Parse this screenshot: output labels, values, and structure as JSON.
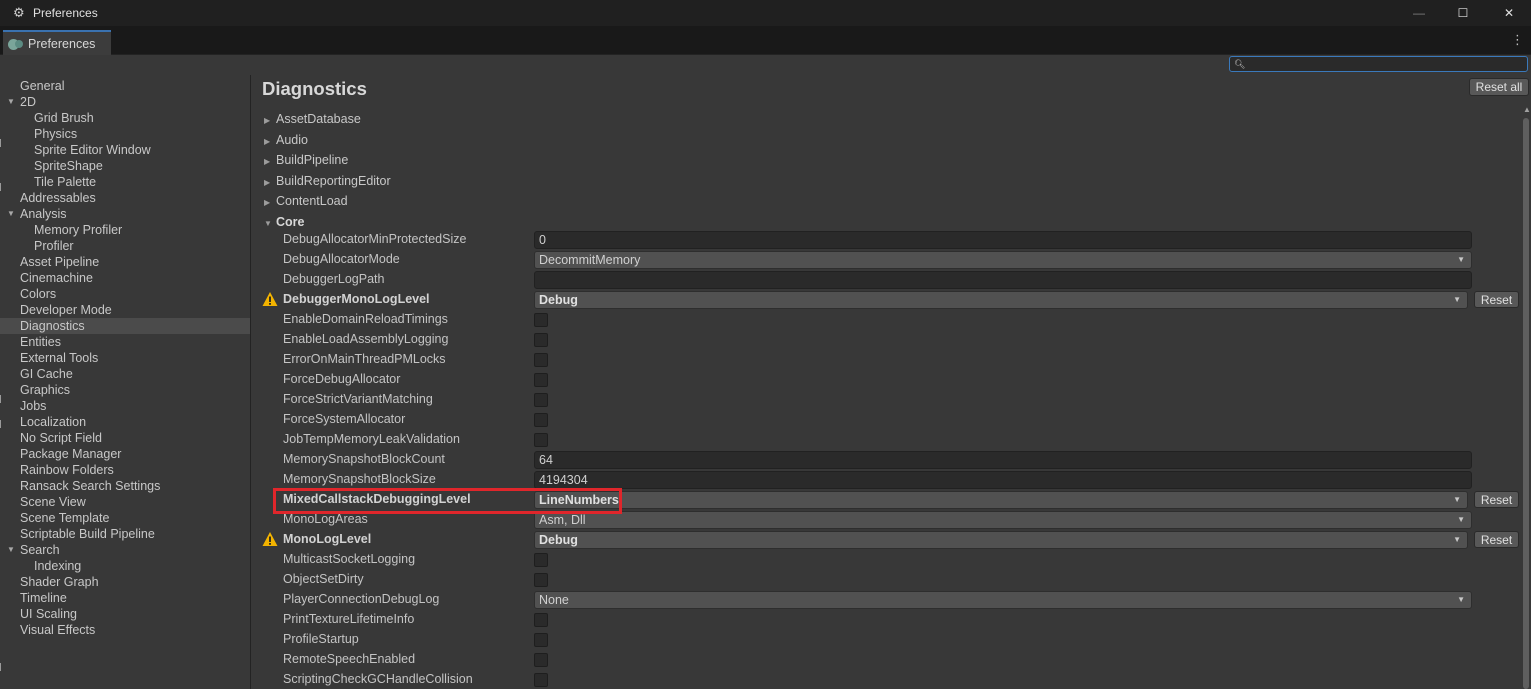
{
  "window": {
    "title": "Preferences",
    "tab_label": "Preferences",
    "minimize_glyph": "—",
    "maximize_glyph": "☐",
    "close_glyph": "✕",
    "more_glyph": "⋮"
  },
  "search": {
    "value": "",
    "placeholder": ""
  },
  "sidebar": {
    "items": [
      {
        "label": "General",
        "level": 0
      },
      {
        "label": "2D",
        "level": 0,
        "expanded": true
      },
      {
        "label": "Grid Brush",
        "level": 1
      },
      {
        "label": "Physics",
        "level": 1
      },
      {
        "label": "Sprite Editor Window",
        "level": 1
      },
      {
        "label": "SpriteShape",
        "level": 1
      },
      {
        "label": "Tile Palette",
        "level": 1
      },
      {
        "label": "Addressables",
        "level": 0
      },
      {
        "label": "Analysis",
        "level": 0,
        "expanded": true
      },
      {
        "label": "Memory Profiler",
        "level": 1
      },
      {
        "label": "Profiler",
        "level": 1
      },
      {
        "label": "Asset Pipeline",
        "level": 0
      },
      {
        "label": "Cinemachine",
        "level": 0
      },
      {
        "label": "Colors",
        "level": 0
      },
      {
        "label": "Developer Mode",
        "level": 0
      },
      {
        "label": "Diagnostics",
        "level": 0,
        "selected": true
      },
      {
        "label": "Entities",
        "level": 0
      },
      {
        "label": "External Tools",
        "level": 0
      },
      {
        "label": "GI Cache",
        "level": 0
      },
      {
        "label": "Graphics",
        "level": 0
      },
      {
        "label": "Jobs",
        "level": 0
      },
      {
        "label": "Localization",
        "level": 0
      },
      {
        "label": "No Script Field",
        "level": 0
      },
      {
        "label": "Package Manager",
        "level": 0
      },
      {
        "label": "Rainbow Folders",
        "level": 0
      },
      {
        "label": "Ransack Search Settings",
        "level": 0
      },
      {
        "label": "Scene View",
        "level": 0
      },
      {
        "label": "Scene Template",
        "level": 0
      },
      {
        "label": "Scriptable Build Pipeline",
        "level": 0
      },
      {
        "label": "Search",
        "level": 0,
        "expanded": true
      },
      {
        "label": "Indexing",
        "level": 1
      },
      {
        "label": "Shader Graph",
        "level": 0
      },
      {
        "label": "Timeline",
        "level": 0
      },
      {
        "label": "UI Scaling",
        "level": 0
      },
      {
        "label": "Visual Effects",
        "level": 0
      }
    ]
  },
  "main": {
    "title": "Diagnostics",
    "reset_all_label": "Reset all",
    "reset_label": "Reset",
    "collapsed_sections": [
      "AssetDatabase",
      "Audio",
      "BuildPipeline",
      "BuildReportingEditor",
      "ContentLoad"
    ],
    "open_section": "Core",
    "properties": [
      {
        "name": "DebugAllocatorMinProtectedSize",
        "type": "text",
        "value": "0"
      },
      {
        "name": "DebugAllocatorMode",
        "type": "dropdown",
        "value": "DecommitMemory"
      },
      {
        "name": "DebuggerLogPath",
        "type": "text",
        "value": ""
      },
      {
        "name": "DebuggerMonoLogLevel",
        "type": "dropdown",
        "value": "Debug",
        "modified": true,
        "warning": true
      },
      {
        "name": "EnableDomainReloadTimings",
        "type": "checkbox",
        "checked": false
      },
      {
        "name": "EnableLoadAssemblyLogging",
        "type": "checkbox",
        "checked": false
      },
      {
        "name": "ErrorOnMainThreadPMLocks",
        "type": "checkbox",
        "checked": false
      },
      {
        "name": "ForceDebugAllocator",
        "type": "checkbox",
        "checked": false
      },
      {
        "name": "ForceStrictVariantMatching",
        "type": "checkbox",
        "checked": false
      },
      {
        "name": "ForceSystemAllocator",
        "type": "checkbox",
        "checked": false
      },
      {
        "name": "JobTempMemoryLeakValidation",
        "type": "checkbox",
        "checked": false
      },
      {
        "name": "MemorySnapshotBlockCount",
        "type": "text",
        "value": "64"
      },
      {
        "name": "MemorySnapshotBlockSize",
        "type": "text",
        "value": "4194304"
      },
      {
        "name": "MixedCallstackDebuggingLevel",
        "type": "dropdown",
        "value": "LineNumbers",
        "modified": true,
        "highlighted": true
      },
      {
        "name": "MonoLogAreas",
        "type": "dropdown",
        "value": "Asm, Dll"
      },
      {
        "name": "MonoLogLevel",
        "type": "dropdown",
        "value": "Debug",
        "modified": true,
        "warning": true
      },
      {
        "name": "MulticastSocketLogging",
        "type": "checkbox",
        "checked": false
      },
      {
        "name": "ObjectSetDirty",
        "type": "checkbox",
        "checked": false
      },
      {
        "name": "PlayerConnectionDebugLog",
        "type": "dropdown",
        "value": "None"
      },
      {
        "name": "PrintTextureLifetimeInfo",
        "type": "checkbox",
        "checked": false
      },
      {
        "name": "ProfileStartup",
        "type": "checkbox",
        "checked": false
      },
      {
        "name": "RemoteSpeechEnabled",
        "type": "checkbox",
        "checked": false
      },
      {
        "name": "ScriptingCheckGCHandleCollision",
        "type": "checkbox",
        "checked": false
      }
    ]
  },
  "colors": {
    "accent": "#3a72b0",
    "highlight_box": "#e0262b",
    "warning": "#f4b400",
    "selected_row": "#4b4b4b"
  },
  "icons": {
    "app": "unity-cog-icon",
    "tab": "preferences-icon",
    "search": "search-icon",
    "warning": "warning-icon"
  }
}
